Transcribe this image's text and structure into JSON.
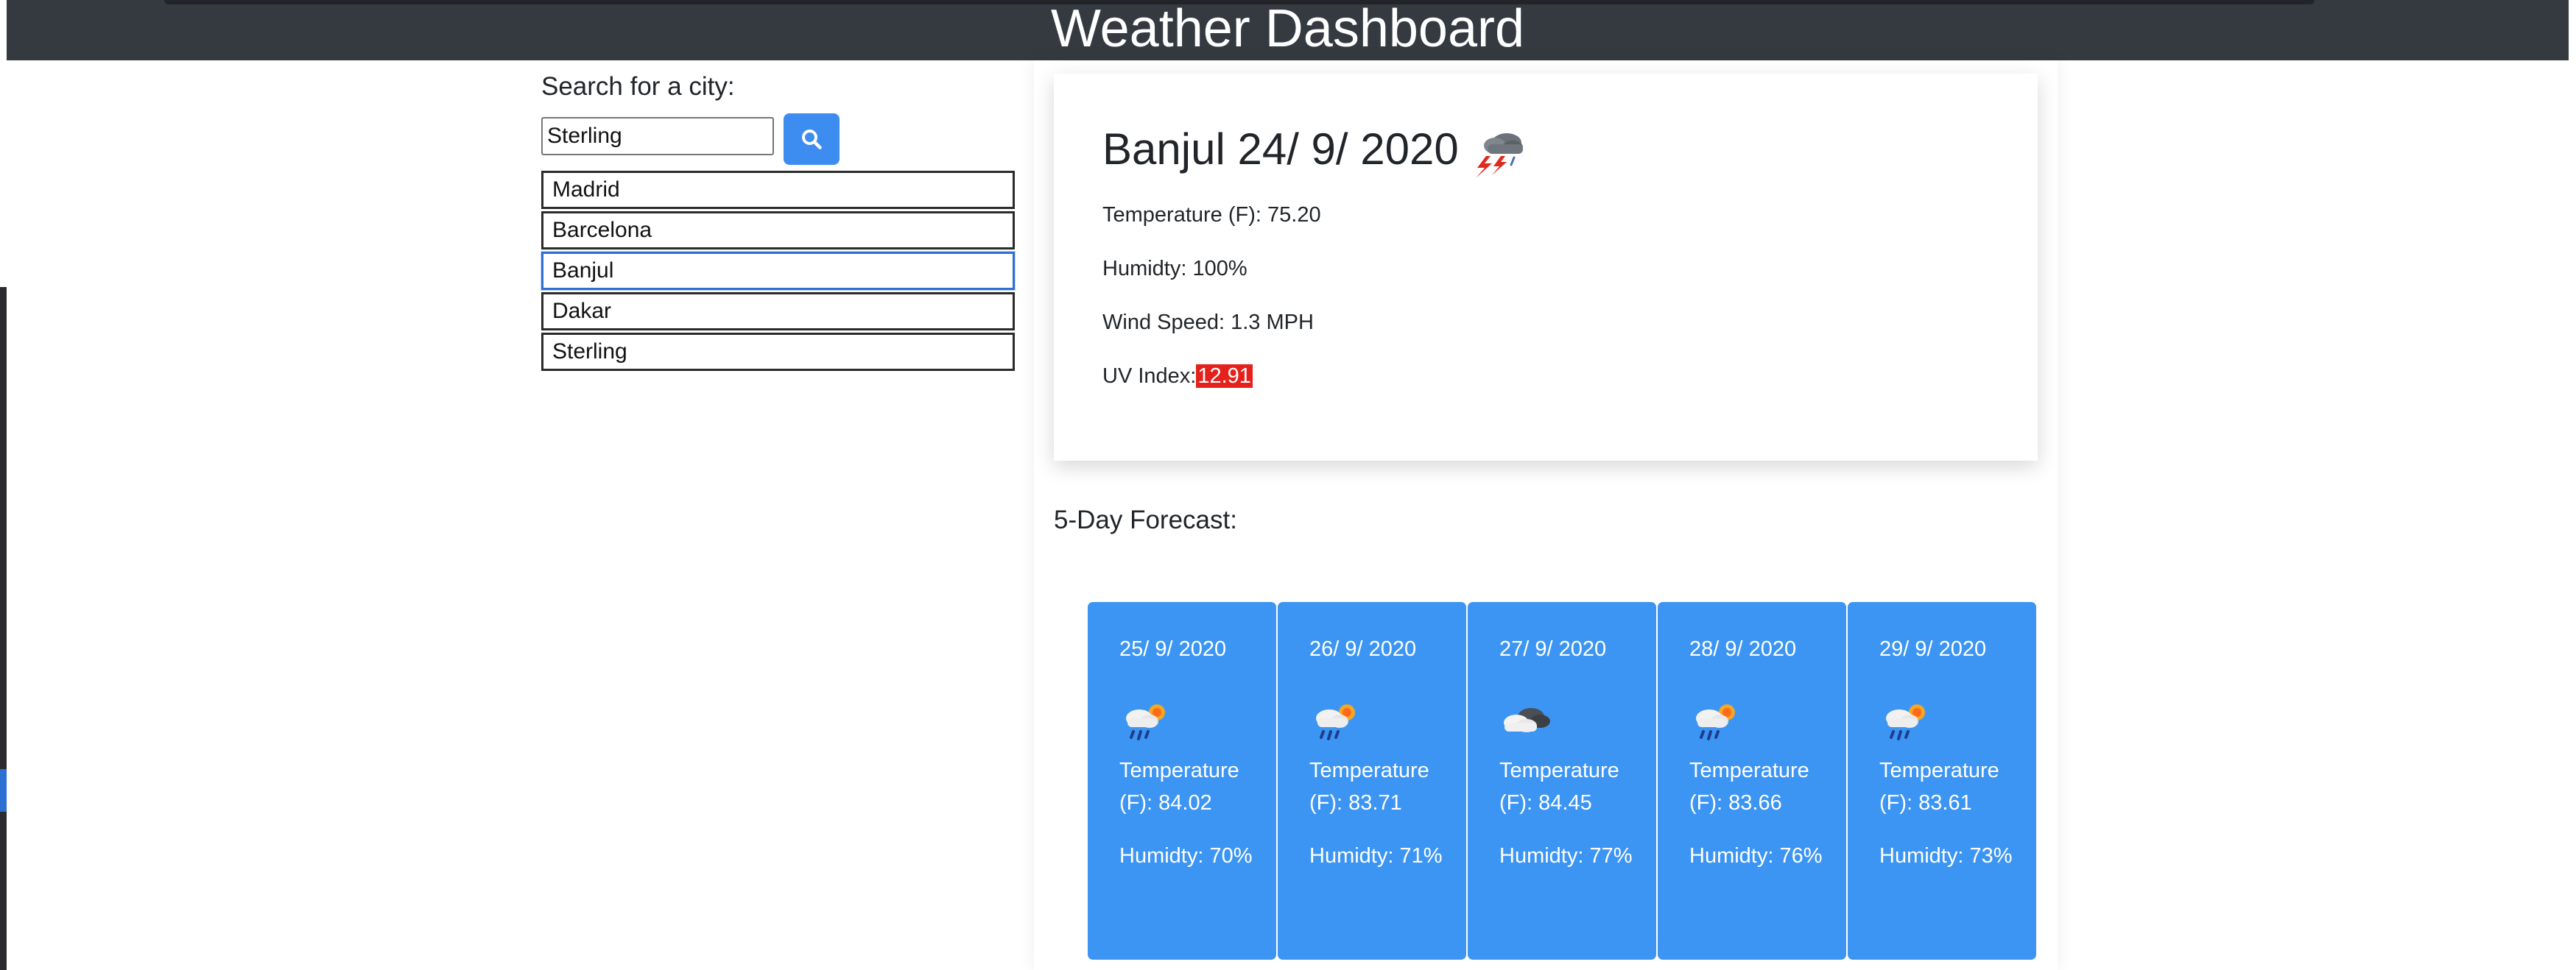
{
  "header": {
    "title": "Weather Dashboard"
  },
  "search": {
    "label": "Search for a city:",
    "value": "Sterling",
    "button_icon": "search-icon"
  },
  "history": {
    "items": [
      "Madrid",
      "Barcelona",
      "Banjul",
      "Dakar",
      "Sterling"
    ],
    "active": "Banjul"
  },
  "current": {
    "title": "Banjul 24/ 9/ 2020",
    "icon": "thunderstorm-icon",
    "temperature": "Temperature (F): 75.20",
    "humidity": "Humidty: 100%",
    "wind": "Wind Speed: 1.3 MPH",
    "uv_label": "UV Index:",
    "uv_value": "12.91",
    "uv_color": "#e5211b"
  },
  "forecast": {
    "heading": "5-Day Forecast:",
    "card_color": "#3d95f3",
    "days": [
      {
        "date": "25/ 9/ 2020",
        "icon": "rain-sun-icon",
        "temp": "Temperature (F): 84.02",
        "humidity": "Humidty: 70%"
      },
      {
        "date": "26/ 9/ 2020",
        "icon": "rain-sun-icon",
        "temp": "Temperature (F): 83.71",
        "humidity": "Humidty: 71%"
      },
      {
        "date": "27/ 9/ 2020",
        "icon": "cloud-icon",
        "temp": "Temperature (F): 84.45",
        "humidity": "Humidty: 77%"
      },
      {
        "date": "28/ 9/ 2020",
        "icon": "rain-sun-icon",
        "temp": "Temperature (F): 83.66",
        "humidity": "Humidty: 76%"
      },
      {
        "date": "29/ 9/ 2020",
        "icon": "rain-sun-icon",
        "temp": "Temperature (F): 83.61",
        "humidity": "Humidty: 73%"
      }
    ]
  }
}
